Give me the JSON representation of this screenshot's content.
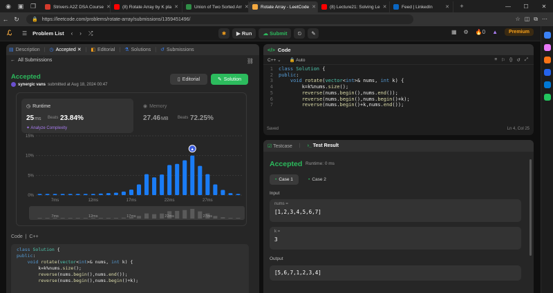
{
  "browser": {
    "tabs": [
      {
        "label": "Strivers A2Z DSA Course",
        "color": "#d33a2c",
        "active": false
      },
      {
        "label": "(8) Rotate Array by K pla",
        "color": "#ff0000",
        "active": false
      },
      {
        "label": "Union of Two Sorted Arr",
        "color": "#2f8d46",
        "active": false
      },
      {
        "label": "Rotate Array - LeetCode",
        "color": "#f4a940",
        "active": true
      },
      {
        "label": "(8) Lecture21: Solving Le",
        "color": "#ff0000",
        "active": false
      },
      {
        "label": "Feed | LinkedIn",
        "color": "#0a66c2",
        "active": false
      }
    ],
    "url": "https://leetcode.com/problems/rotate-array/submissions/1359451496/"
  },
  "topbar": {
    "problem_list": "Problem List",
    "run": "Run",
    "submit": "Submit",
    "streak": "0",
    "premium": "Premium"
  },
  "left": {
    "tabs": [
      "Description",
      "Accepted",
      "Editorial",
      "Solutions",
      "Submissions"
    ],
    "all_submissions": "All Submissions",
    "status": "Accepted",
    "user": "synergic vans",
    "submitted": "submitted at Aug 18, 2024 00:47",
    "editorial_btn": "Editorial",
    "solution_btn": "Solution",
    "runtime": {
      "title": "Runtime",
      "value": "25",
      "unit": "ms",
      "beats_label": "Beats",
      "beats": "23.84%",
      "analyze": "Analyze Complexity"
    },
    "memory": {
      "title": "Memory",
      "value": "27.46",
      "unit": "MB",
      "beats_label": "Beats",
      "beats": "72.25%"
    },
    "code_label": "Code",
    "code_lang": "C++",
    "code_lines": [
      "class Solution {",
      "public:",
      "    void rotate(vector<int>& nums, int k) {",
      "        k=k%nums.size();",
      "        reverse(nums.begin(),nums.end());",
      "        reverse(nums.begin(),nums.begin()+k);"
    ]
  },
  "chart_data": {
    "type": "bar",
    "ylabel": "",
    "yticks": [
      "15%",
      "10%",
      "5%",
      "0%"
    ],
    "ylim": [
      0,
      15
    ],
    "xticks": [
      "7ms",
      "12ms",
      "17ms",
      "22ms",
      "27ms"
    ],
    "values": [
      0.3,
      0.3,
      0.3,
      0.3,
      0.3,
      0.3,
      0.3,
      0.3,
      0.4,
      0.5,
      0.6,
      0.9,
      1.4,
      2.7,
      5.3,
      4.5,
      5.2,
      7.6,
      7.9,
      8.8,
      10,
      7.4,
      5.3,
      2.7,
      1.3,
      0.5,
      0.3
    ],
    "highlight_index": 20,
    "brush_xticks": [
      "7ms",
      "12ms",
      "17ms",
      "22ms",
      "27ms"
    ]
  },
  "code_panel": {
    "title": "Code",
    "lang": "C++",
    "mode": "Auto",
    "lines": [
      "class Solution {",
      "public:",
      "    void rotate(vector<int>& nums, int k) {",
      "        k=k%nums.size();",
      "        reverse(nums.begin(),nums.end());",
      "        reverse(nums.begin(),nums.begin()+k);",
      "        reverse(nums.begin()+k,nums.end());"
    ],
    "saved": "Saved",
    "cursor": "Ln 4, Col 25"
  },
  "test": {
    "tab1": "Testcase",
    "tab2": "Test Result",
    "status": "Accepted",
    "runtime": "Runtime: 0 ms",
    "case1": "Case 1",
    "case2": "Case 2",
    "input_label": "Input",
    "nums_name": "nums =",
    "nums_val": "[1,2,3,4,5,6,7]",
    "k_name": "k =",
    "k_val": "3",
    "output_label": "Output",
    "output_val": "[5,6,7,1,2,3,4]"
  }
}
